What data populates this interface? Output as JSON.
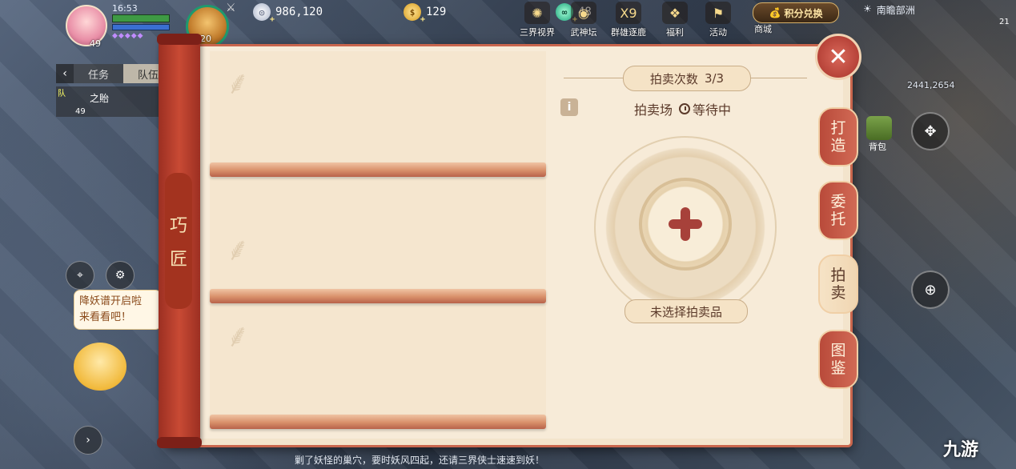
{
  "hud": {
    "time": "16:53",
    "player_level": "49",
    "pet_level": "20",
    "silver": "986,120",
    "gold": "129",
    "jade": "48",
    "menu": [
      {
        "label": "三界视界",
        "icon": "globe-icon"
      },
      {
        "label": "武神坛",
        "icon": "altar-icon"
      },
      {
        "label": "群雄逐鹿",
        "icon": "x9-icon"
      },
      {
        "label": "福利",
        "icon": "gift-icon"
      },
      {
        "label": "活动",
        "icon": "flag-icon"
      },
      {
        "label": "商城",
        "icon": "shop-icon"
      }
    ],
    "redeem_label": "积分兑换",
    "region": "南瞻部洲",
    "minimap_num": "21",
    "coords": "2441,2654",
    "bag_label": "背包"
  },
  "left_panel": {
    "tabs": [
      "任务",
      "队伍"
    ],
    "team_member": "之貽",
    "team_badge": "队",
    "team_level": "49",
    "chat_bubble_line1": "降妖谱开启啦",
    "chat_bubble_line2": "来看看吧！"
  },
  "bottom_chat": "剿了妖怪的巢穴，要时妖风四起，还请三界侠士速速到妖！",
  "watermark": "九游",
  "panel": {
    "banner_chars": [
      "巧",
      "匠"
    ],
    "auction_count_label": "拍卖次数",
    "auction_count_value": "3/3",
    "market_label": "拍卖场",
    "status_label": "等待中",
    "unselected_label": "未选择拍卖品",
    "side_tabs": [
      {
        "label_1": "打",
        "label_2": "造",
        "active": false
      },
      {
        "label_1": "委",
        "label_2": "托",
        "active": false
      },
      {
        "label_1": "拍",
        "label_2": "卖",
        "active": true
      },
      {
        "label_1": "图",
        "label_2": "鉴",
        "active": false
      }
    ]
  }
}
